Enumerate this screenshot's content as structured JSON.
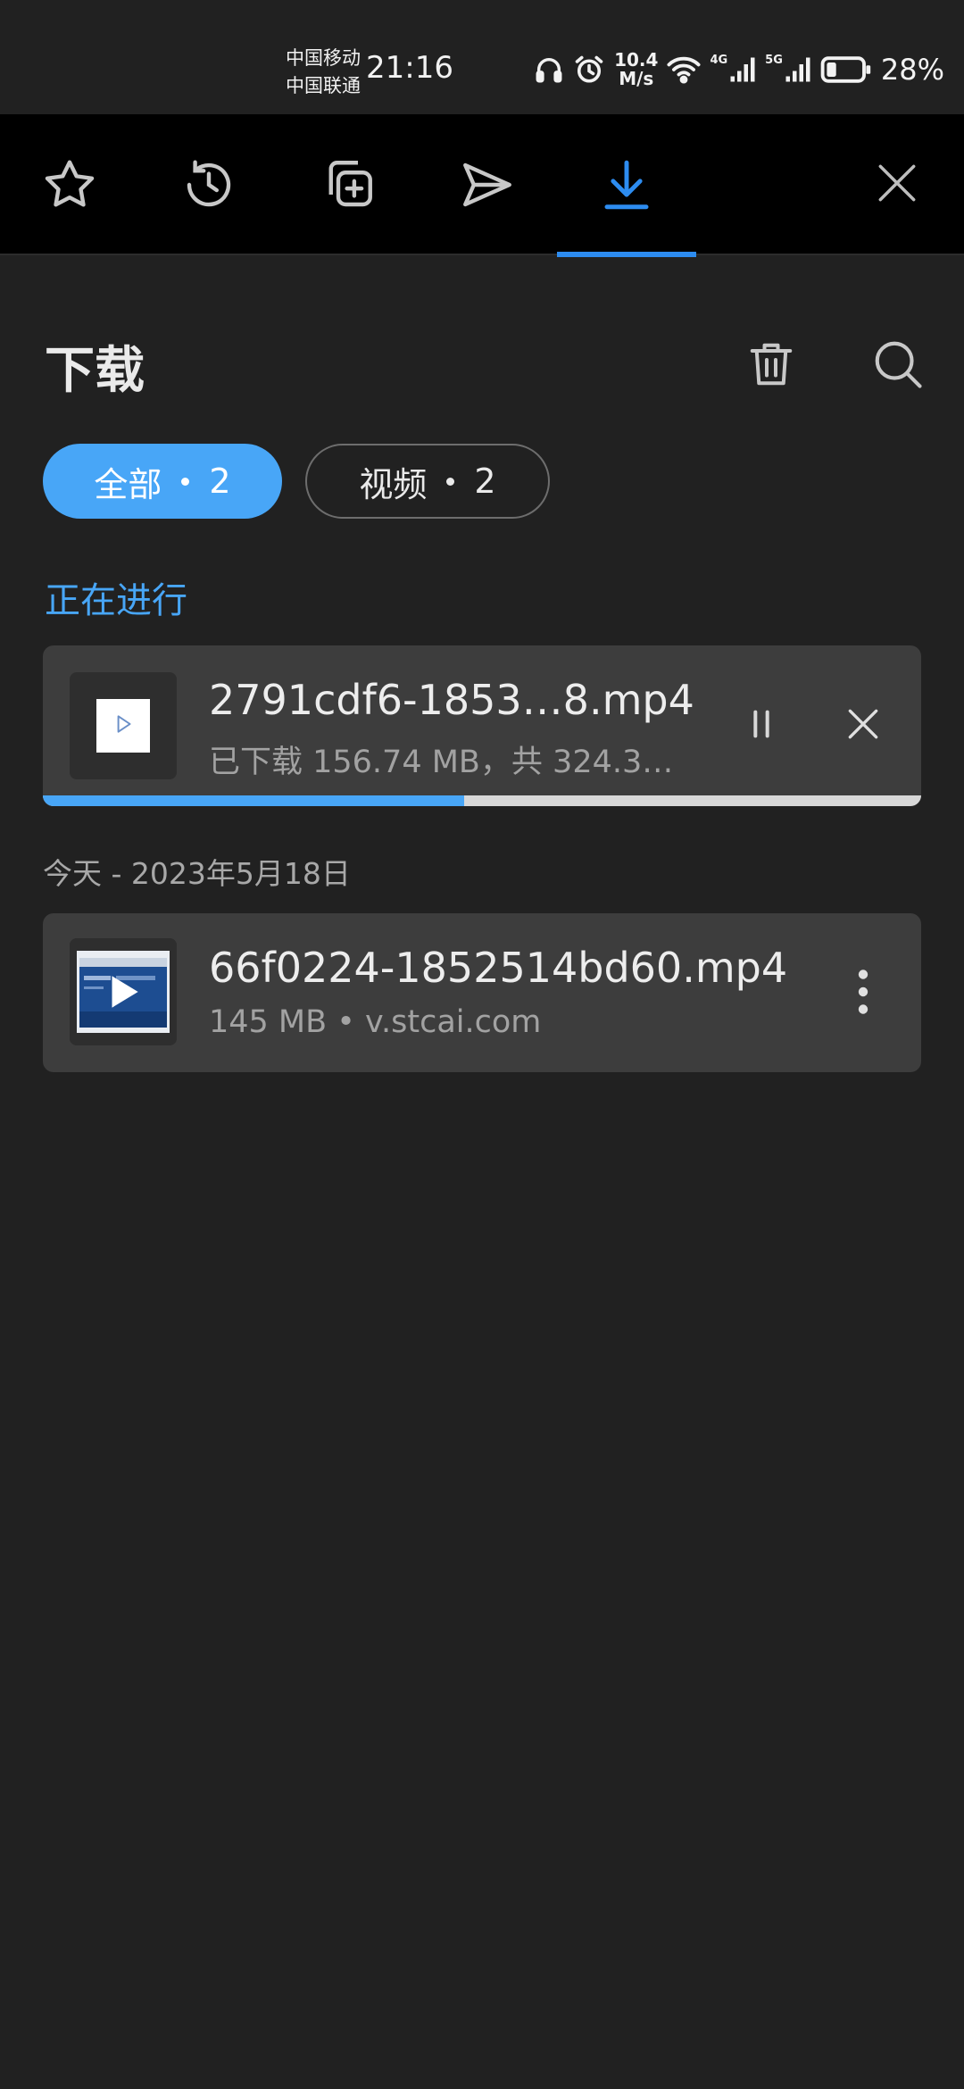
{
  "status_bar": {
    "carrier_1": "中国移动",
    "carrier_2": "中国联通",
    "time": "21:16",
    "net_speed_value": "10.4",
    "net_speed_unit": "M/s",
    "signal_1_label": "4G",
    "signal_2_label": "5G",
    "battery": "28%",
    "battery_level": 0.28,
    "icons": [
      "headphones-icon",
      "alarm-icon",
      "wifi-icon",
      "signal-icon",
      "battery-icon"
    ]
  },
  "toolbar": {
    "tabs": [
      "star-icon",
      "history-icon",
      "add-tab-icon",
      "send-icon",
      "download-icon"
    ],
    "active_tab": "download-icon",
    "close_icon": "close-icon"
  },
  "header": {
    "title": "下载",
    "actions": [
      "trash-icon",
      "search-icon"
    ]
  },
  "filters": [
    {
      "label": "全部",
      "count": "2",
      "selected": true
    },
    {
      "label": "视频",
      "count": "2",
      "selected": false
    }
  ],
  "in_progress": {
    "label": "正在进行",
    "item": {
      "name": "2791cdf6-1853…8.mp4",
      "meta": "已下载 156.74 MB，共 324.3…",
      "progress": 0.48
    }
  },
  "completed": {
    "date_label": "今天 - 2023年5月18日",
    "item": {
      "name": "66f0224-1852514bd60.mp4",
      "meta": "145 MB • v.stcai.com"
    }
  },
  "colors": {
    "accent": "#48a6f7",
    "active_tab": "#2d8cf0",
    "background": "#212121",
    "card": "#3d3d3d"
  }
}
